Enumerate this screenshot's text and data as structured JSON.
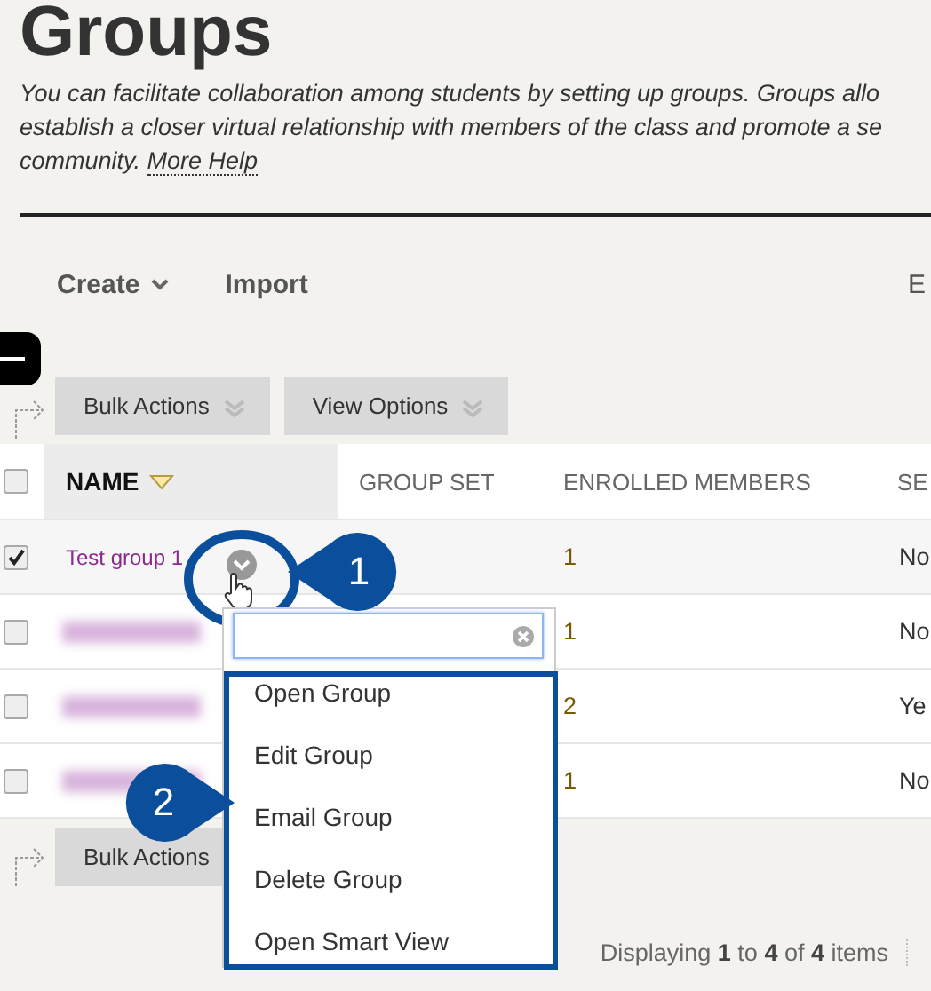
{
  "title": "Groups",
  "description": {
    "lines": [
      "You can facilitate collaboration among students by setting up groups. Groups allo",
      "establish a closer virtual relationship with members of the class and promote a se",
      "community."
    ],
    "link": "More Help"
  },
  "toolbar": [
    {
      "label": "Create",
      "kind": "menu"
    },
    {
      "label": "Import",
      "kind": "plain"
    },
    {
      "label": "E",
      "kind": "edge"
    }
  ],
  "action_bar": [
    "Bulk Actions",
    "View Options"
  ],
  "table": {
    "select_all_checked": false,
    "columns": [
      {
        "label": "NAME",
        "sorted": true
      },
      {
        "label": "GROUP SET",
        "sorted": false
      },
      {
        "label": "ENROLLED MEMBERS",
        "sorted": false
      },
      {
        "label": "SE",
        "sorted": false
      }
    ],
    "rows": [
      {
        "kind": "link",
        "name": "Test group 1",
        "checked": true,
        "enrolled": "1",
        "column_4": "No"
      },
      {
        "kind": "blurred",
        "checked": false,
        "enrolled": "1",
        "column_4": "No"
      },
      {
        "kind": "blurred",
        "checked": false,
        "enrolled": "2",
        "column_4": "Ye"
      },
      {
        "kind": "blurred",
        "checked": false,
        "enrolled": "1",
        "column_4": "No"
      }
    ]
  },
  "bottom_bar": {
    "button": "Bulk Actions",
    "paging": "Displaying **1** to **4** of **4** items"
  },
  "dropdown": {
    "items": [
      "Open Group",
      "Edit Group",
      "Email Group",
      "Delete Group",
      "Open Smart View"
    ]
  },
  "callouts": [
    {
      "label": "1"
    },
    {
      "label": "2"
    }
  ]
}
